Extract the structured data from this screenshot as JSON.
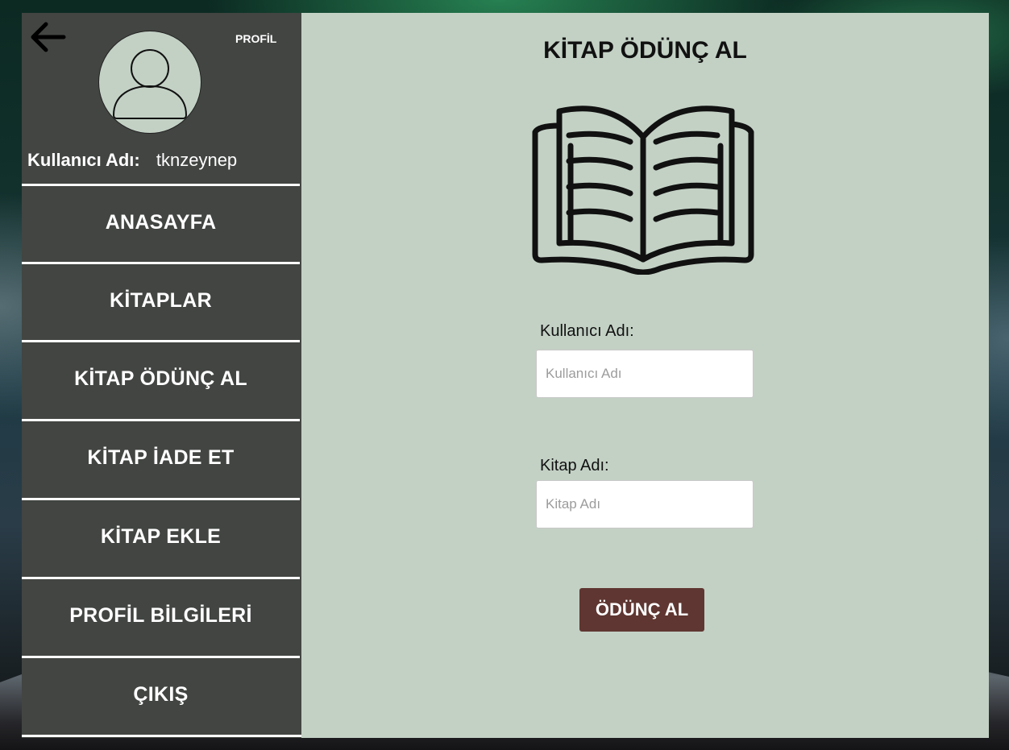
{
  "sidebar": {
    "back_icon": "arrow-left-icon",
    "avatar_icon": "user-icon",
    "profile_label": "PROFİL",
    "username_label": "Kullanıcı Adı:",
    "username_value": "tknzeynep",
    "items": [
      {
        "label": "ANASAYFA"
      },
      {
        "label": "KİTAPLAR"
      },
      {
        "label": "KİTAP ÖDÜNÇ AL"
      },
      {
        "label": "KİTAP İADE ET"
      },
      {
        "label": "KİTAP EKLE"
      },
      {
        "label": "PROFİL BİLGİLERİ"
      },
      {
        "label": "ÇIKIŞ"
      }
    ]
  },
  "main": {
    "title": "KİTAP ÖDÜNÇ AL",
    "book_icon": "open-book-icon",
    "username_field": {
      "label": "Kullanıcı Adı:",
      "placeholder": "Kullanıcı Adı",
      "value": ""
    },
    "book_field": {
      "label": "Kitap Adı:",
      "placeholder": "Kitap Adı",
      "value": ""
    },
    "submit_label": "ÖDÜNÇ AL"
  },
  "colors": {
    "sidebar_bg": "#424542",
    "main_bg": "#c3d1c5",
    "button_bg": "#5f3631",
    "text_light": "#ffffff",
    "text_dark": "#111111"
  }
}
